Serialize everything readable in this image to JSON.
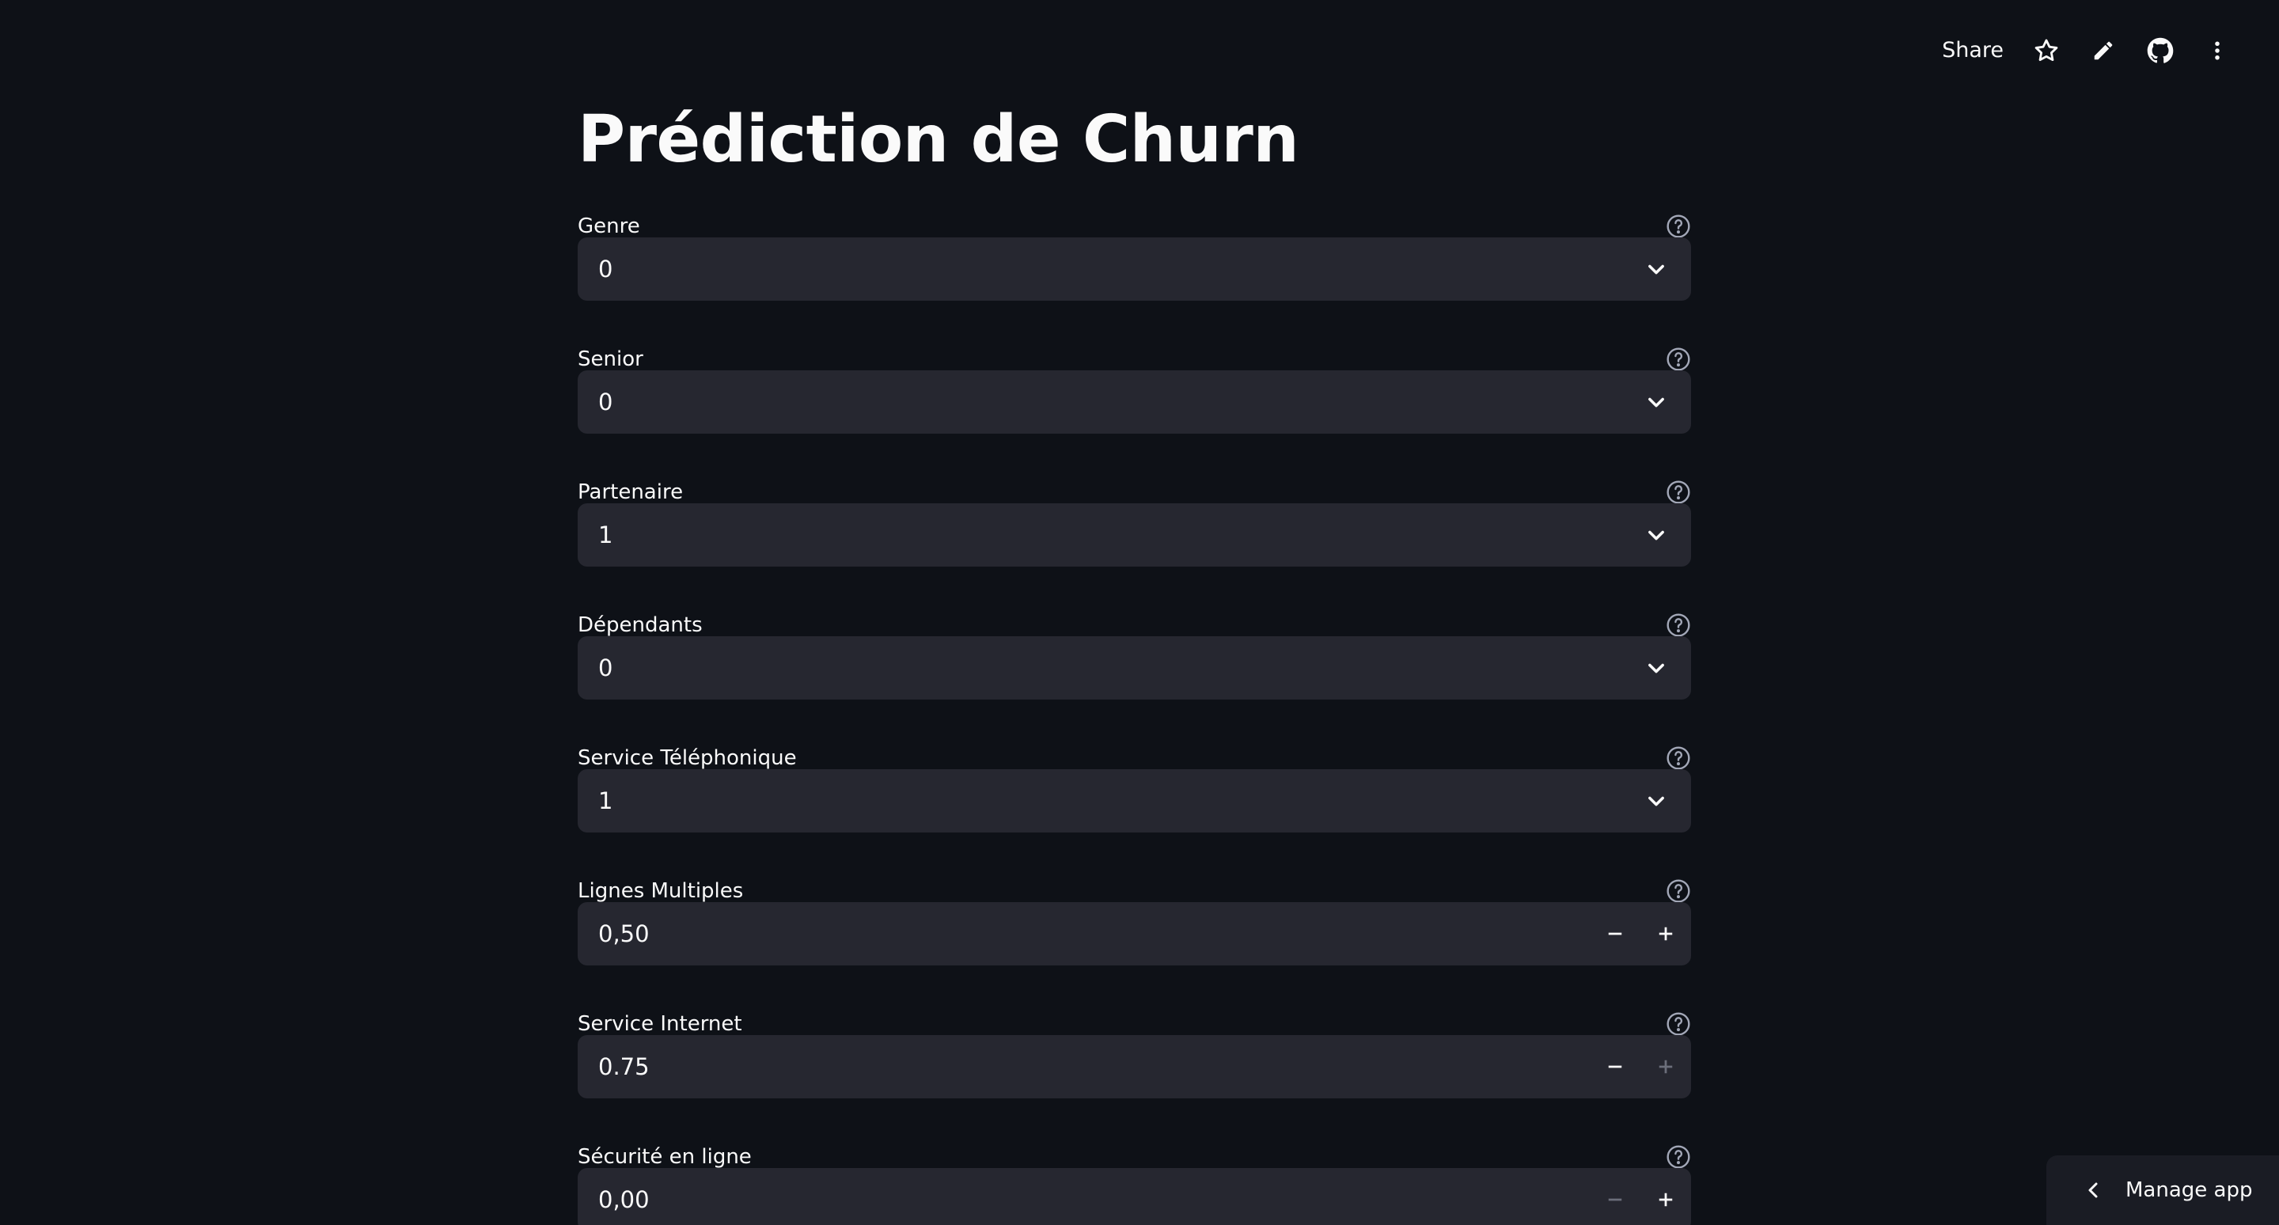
{
  "toolbar": {
    "share_label": "Share",
    "icons": [
      "star-icon",
      "pencil-icon",
      "github-icon",
      "more-vertical-icon"
    ]
  },
  "title": "Prédiction de Churn",
  "fields": [
    {
      "label": "Genre",
      "type": "select",
      "value": "0"
    },
    {
      "label": "Senior",
      "type": "select",
      "value": "0"
    },
    {
      "label": "Partenaire",
      "type": "select",
      "value": "1"
    },
    {
      "label": "Dépendants",
      "type": "select",
      "value": "0"
    },
    {
      "label": "Service Téléphonique",
      "type": "select",
      "value": "1"
    },
    {
      "label": "Lignes Multiples",
      "type": "number",
      "value": "0,50"
    },
    {
      "label": "Service Internet",
      "type": "number",
      "value": "0.75"
    },
    {
      "label": "Sécurité en ligne",
      "type": "number",
      "value": "0,00"
    }
  ],
  "manage_app": {
    "label": "Manage app"
  },
  "colors": {
    "background": "#0e1117",
    "input_background": "#262730",
    "text": "#fafafa",
    "muted": "#a3a8b8"
  }
}
